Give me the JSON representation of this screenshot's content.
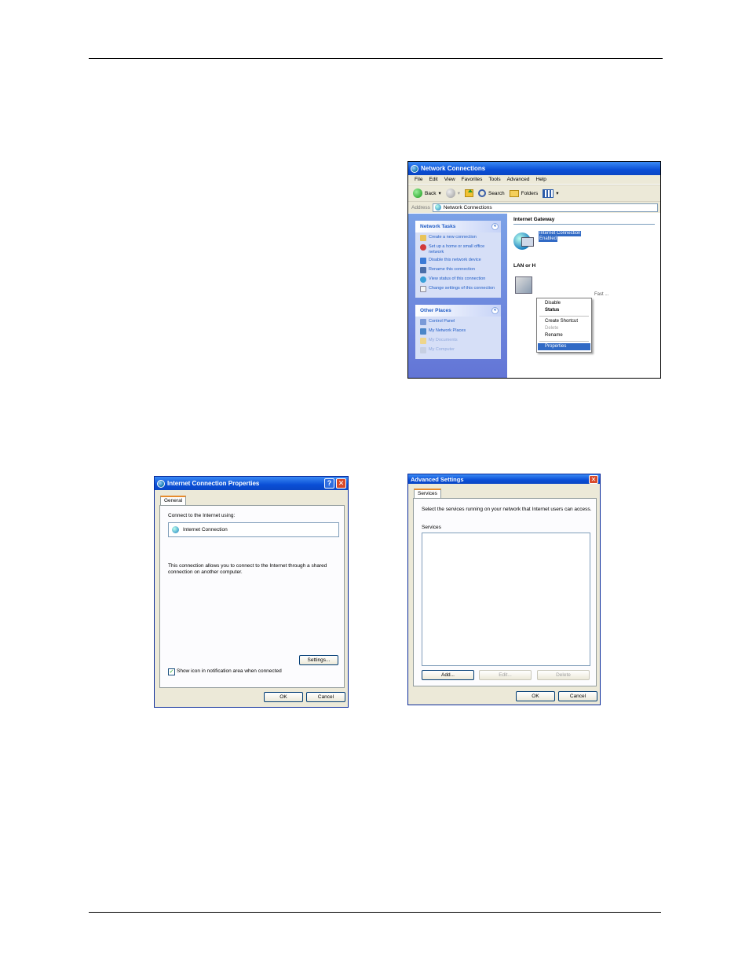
{
  "network_connections": {
    "title": "Network Connections",
    "menu": [
      "File",
      "Edit",
      "View",
      "Favorites",
      "Tools",
      "Advanced",
      "Help"
    ],
    "toolbar": {
      "back": "Back",
      "search": "Search",
      "folders": "Folders"
    },
    "address_label": "Address",
    "address_value": "Network Connections",
    "network_tasks": {
      "title": "Network Tasks",
      "items": [
        "Create a new connection",
        "Set up a home or small office network",
        "Disable this network device",
        "Rename this connection",
        "View status of this connection",
        "Change settings of this connection"
      ]
    },
    "other_places": {
      "title": "Other Places",
      "items": [
        "Control Panel",
        "My Network Places",
        "My Documents",
        "My Computer"
      ]
    },
    "gateway_group": "Internet Gateway",
    "connection_name": "Internet Connection",
    "connection_status": "Enabled",
    "lan_group": "LAN or H",
    "lan_text": "Fast ...",
    "context_menu": [
      "Disable",
      "Status",
      "Create Shortcut",
      "Delete",
      "Rename",
      "Properties"
    ]
  },
  "icp_dialog": {
    "title": "Internet Connection Properties",
    "tab": "General",
    "connect_using_label": "Connect to the Internet using:",
    "connection": "Internet Connection",
    "description": "This connection allows you to connect to the Internet through a shared connection on another computer.",
    "settings_button": "Settings...",
    "show_icon_label": "Show icon in notification area when connected",
    "show_icon_checked": true,
    "ok": "OK",
    "cancel": "Cancel"
  },
  "adv_dialog": {
    "title": "Advanced Settings",
    "tab": "Services",
    "description": "Select the services running on your network that Internet users can access.",
    "services_label": "Services",
    "add": "Add...",
    "edit": "Edit...",
    "delete": "Delete",
    "ok": "OK",
    "cancel": "Cancel"
  }
}
